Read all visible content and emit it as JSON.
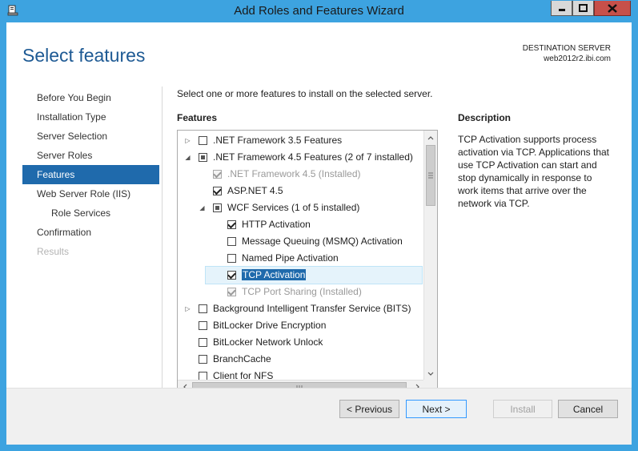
{
  "window": {
    "title": "Add Roles and Features Wizard",
    "icons": {
      "app": "server-manager-icon",
      "minimize": "minimize-icon",
      "maximize": "maximize-icon",
      "close": "close-icon"
    }
  },
  "header": {
    "page_title": "Select features",
    "destination_label": "DESTINATION SERVER",
    "destination_server": "web2012r2.ibi.com"
  },
  "nav": {
    "items": [
      {
        "label": "Before You Begin",
        "state": "normal",
        "sub": false
      },
      {
        "label": "Installation Type",
        "state": "normal",
        "sub": false
      },
      {
        "label": "Server Selection",
        "state": "normal",
        "sub": false
      },
      {
        "label": "Server Roles",
        "state": "normal",
        "sub": false
      },
      {
        "label": "Features",
        "state": "active",
        "sub": false
      },
      {
        "label": "Web Server Role (IIS)",
        "state": "normal",
        "sub": false
      },
      {
        "label": "Role Services",
        "state": "normal",
        "sub": true
      },
      {
        "label": "Confirmation",
        "state": "normal",
        "sub": false
      },
      {
        "label": "Results",
        "state": "disabled",
        "sub": false
      }
    ]
  },
  "main": {
    "instruction": "Select one or more features to install on the selected server.",
    "features_heading": "Features",
    "features": [
      {
        "label": ".NET Framework 3.5 Features",
        "level": 0,
        "expander": "collapsed",
        "check": "unchecked",
        "disabled": false,
        "selected": false
      },
      {
        "label": ".NET Framework 4.5 Features (2 of 7 installed)",
        "level": 0,
        "expander": "expanded",
        "check": "partial",
        "disabled": false,
        "selected": false
      },
      {
        "label": ".NET Framework 4.5 (Installed)",
        "level": 1,
        "expander": "none",
        "check": "checked",
        "disabled": true,
        "selected": false
      },
      {
        "label": "ASP.NET 4.5",
        "level": 1,
        "expander": "none",
        "check": "checked",
        "disabled": false,
        "selected": false
      },
      {
        "label": "WCF Services (1 of 5 installed)",
        "level": 1,
        "expander": "expanded",
        "check": "partial",
        "disabled": false,
        "selected": false
      },
      {
        "label": "HTTP Activation",
        "level": 2,
        "expander": "none",
        "check": "checked",
        "disabled": false,
        "selected": false
      },
      {
        "label": "Message Queuing (MSMQ) Activation",
        "level": 2,
        "expander": "none",
        "check": "unchecked",
        "disabled": false,
        "selected": false
      },
      {
        "label": "Named Pipe Activation",
        "level": 2,
        "expander": "none",
        "check": "unchecked",
        "disabled": false,
        "selected": false
      },
      {
        "label": "TCP Activation",
        "level": 2,
        "expander": "none",
        "check": "checked",
        "disabled": false,
        "selected": true
      },
      {
        "label": "TCP Port Sharing (Installed)",
        "level": 2,
        "expander": "none",
        "check": "checked",
        "disabled": true,
        "selected": false
      },
      {
        "label": "Background Intelligent Transfer Service (BITS)",
        "level": 0,
        "expander": "collapsed",
        "check": "unchecked",
        "disabled": false,
        "selected": false
      },
      {
        "label": "BitLocker Drive Encryption",
        "level": 0,
        "expander": "none",
        "check": "unchecked",
        "disabled": false,
        "selected": false
      },
      {
        "label": "BitLocker Network Unlock",
        "level": 0,
        "expander": "none",
        "check": "unchecked",
        "disabled": false,
        "selected": false
      },
      {
        "label": "BranchCache",
        "level": 0,
        "expander": "none",
        "check": "unchecked",
        "disabled": false,
        "selected": false
      },
      {
        "label": "Client for NFS",
        "level": 0,
        "expander": "none",
        "check": "unchecked",
        "disabled": false,
        "selected": false
      }
    ]
  },
  "description": {
    "heading": "Description",
    "text": "TCP Activation supports process activation via TCP. Applications that use TCP Activation can start and stop dynamically in response to work items that arrive over the network via TCP."
  },
  "footer": {
    "previous_label": "< Previous",
    "next_label": "Next >",
    "install_label": "Install",
    "cancel_label": "Cancel"
  },
  "colors": {
    "accent": "#1f6aac",
    "title_bar": "#3da3e0",
    "close_button": "#c7504a"
  }
}
